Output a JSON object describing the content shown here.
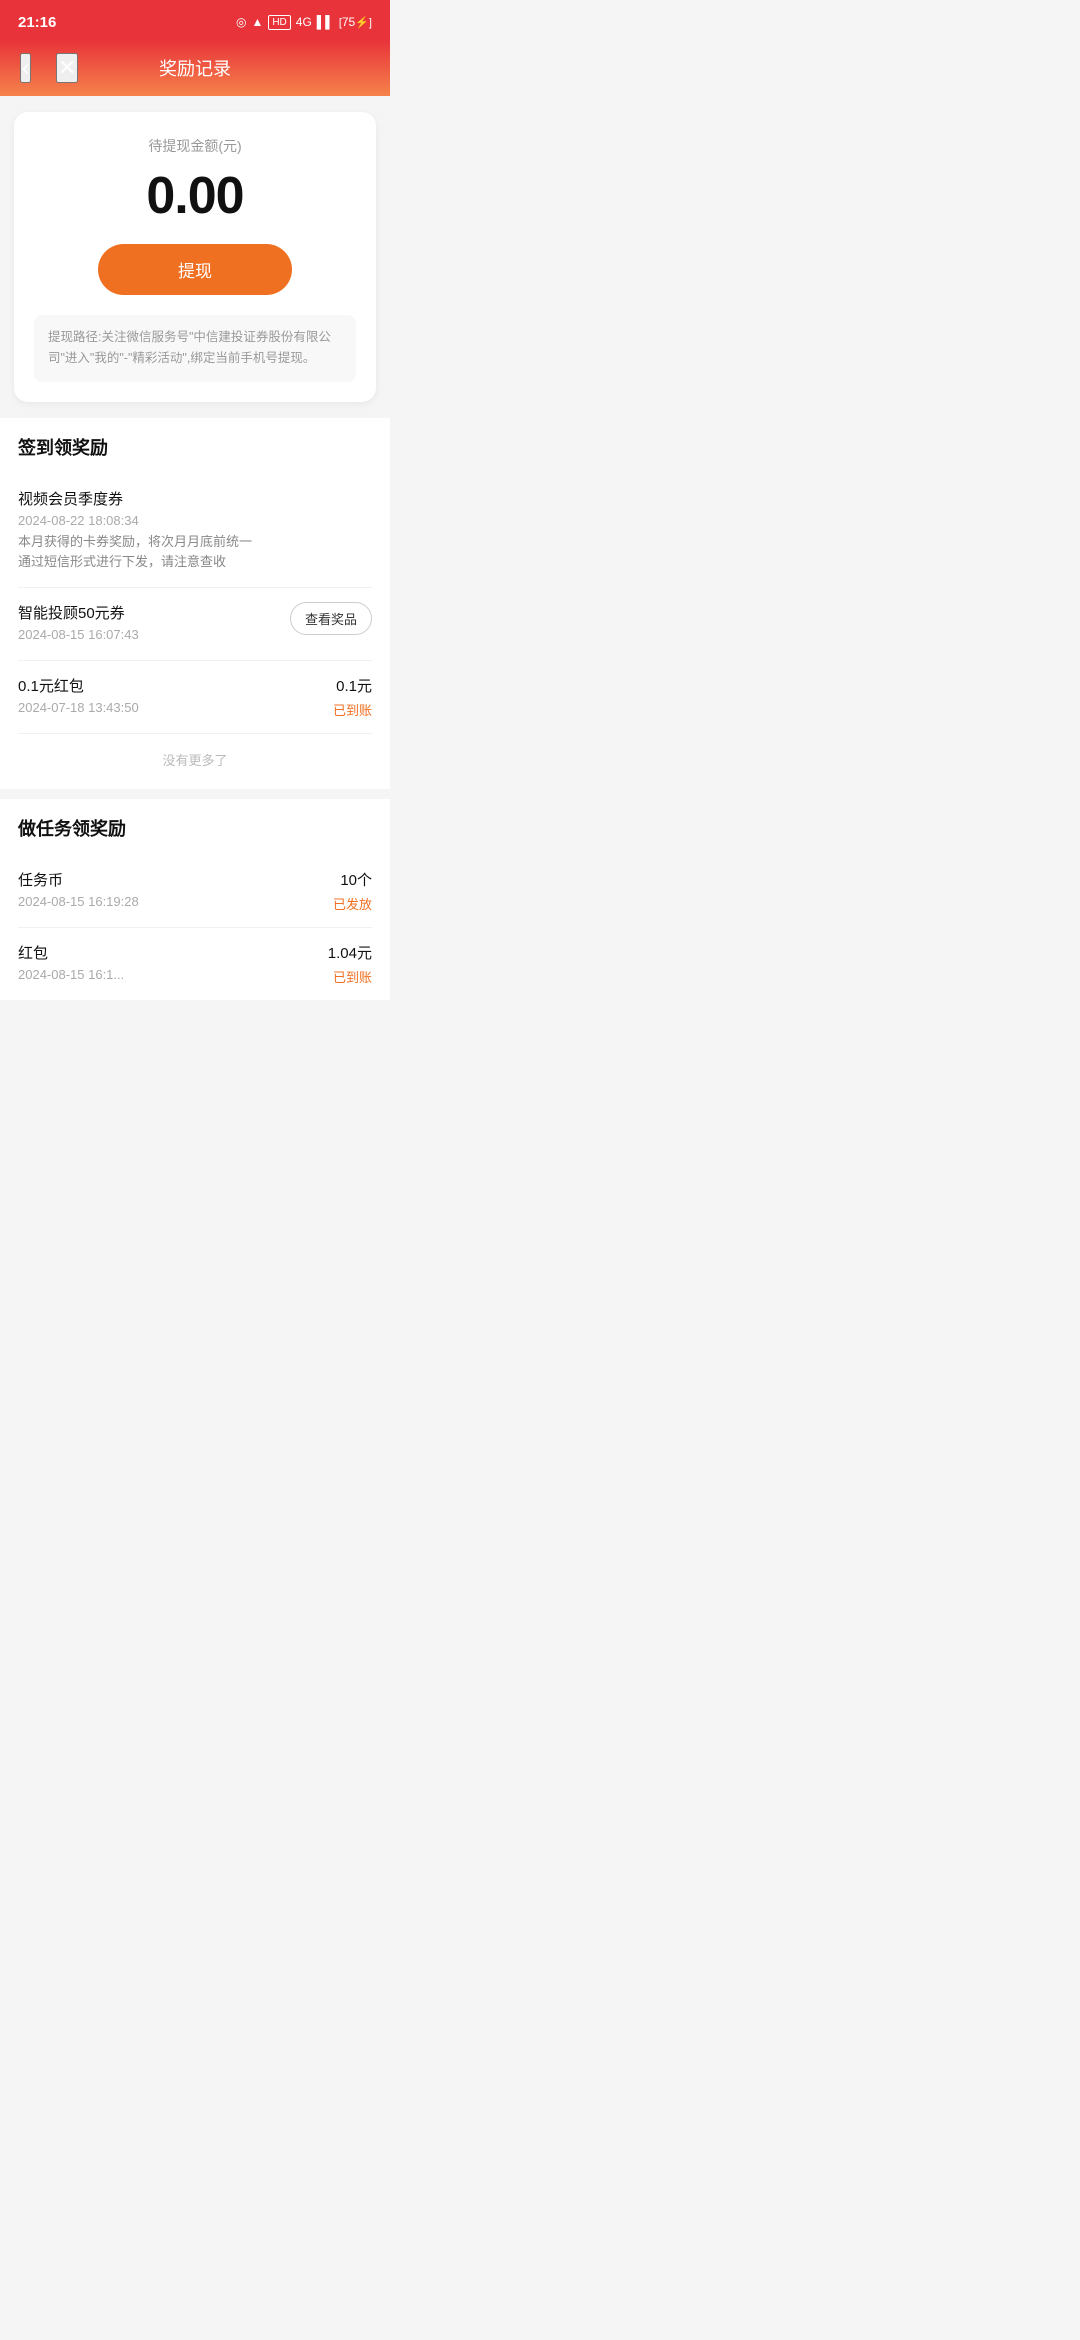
{
  "statusBar": {
    "time": "21:16",
    "batteryLevel": "75"
  },
  "header": {
    "title": "奖励记录",
    "backLabel": "‹",
    "closeLabel": "✕"
  },
  "balanceCard": {
    "label": "待提现金额(元)",
    "amount": "0.00",
    "withdrawBtn": "提现",
    "note": "提现路径:关注微信服务号\"中信建投证券股份有限公司\"进入\"我的\"-\"精彩活动\",绑定当前手机号提现。"
  },
  "checkinSection": {
    "title": "签到领奖励",
    "records": [
      {
        "name": "视频会员季度券",
        "date": "2024-08-22 18:08:34",
        "desc": "本月获得的卡券奖励，将次月月底前统一通过短信形式进行下发，请注意查收",
        "amount": "",
        "status": "",
        "hasViewBtn": false
      },
      {
        "name": "智能投顾50元券",
        "date": "2024-08-15 16:07:43",
        "desc": "",
        "amount": "",
        "status": "",
        "hasViewBtn": true,
        "viewBtnLabel": "查看奖品"
      },
      {
        "name": "0.1元红包",
        "date": "2024-07-18 13:43:50",
        "desc": "",
        "amount": "0.1元",
        "status": "已到账",
        "hasViewBtn": false
      }
    ],
    "noMore": "没有更多了"
  },
  "taskSection": {
    "title": "做任务领奖励",
    "records": [
      {
        "name": "任务币",
        "date": "2024-08-15 16:19:28",
        "desc": "",
        "amount": "10个",
        "status": "已发放",
        "hasViewBtn": false
      },
      {
        "name": "红包",
        "date": "2024-08-15 16:1...",
        "desc": "",
        "amount": "1.04元",
        "status": "已到账",
        "hasViewBtn": false
      }
    ]
  }
}
